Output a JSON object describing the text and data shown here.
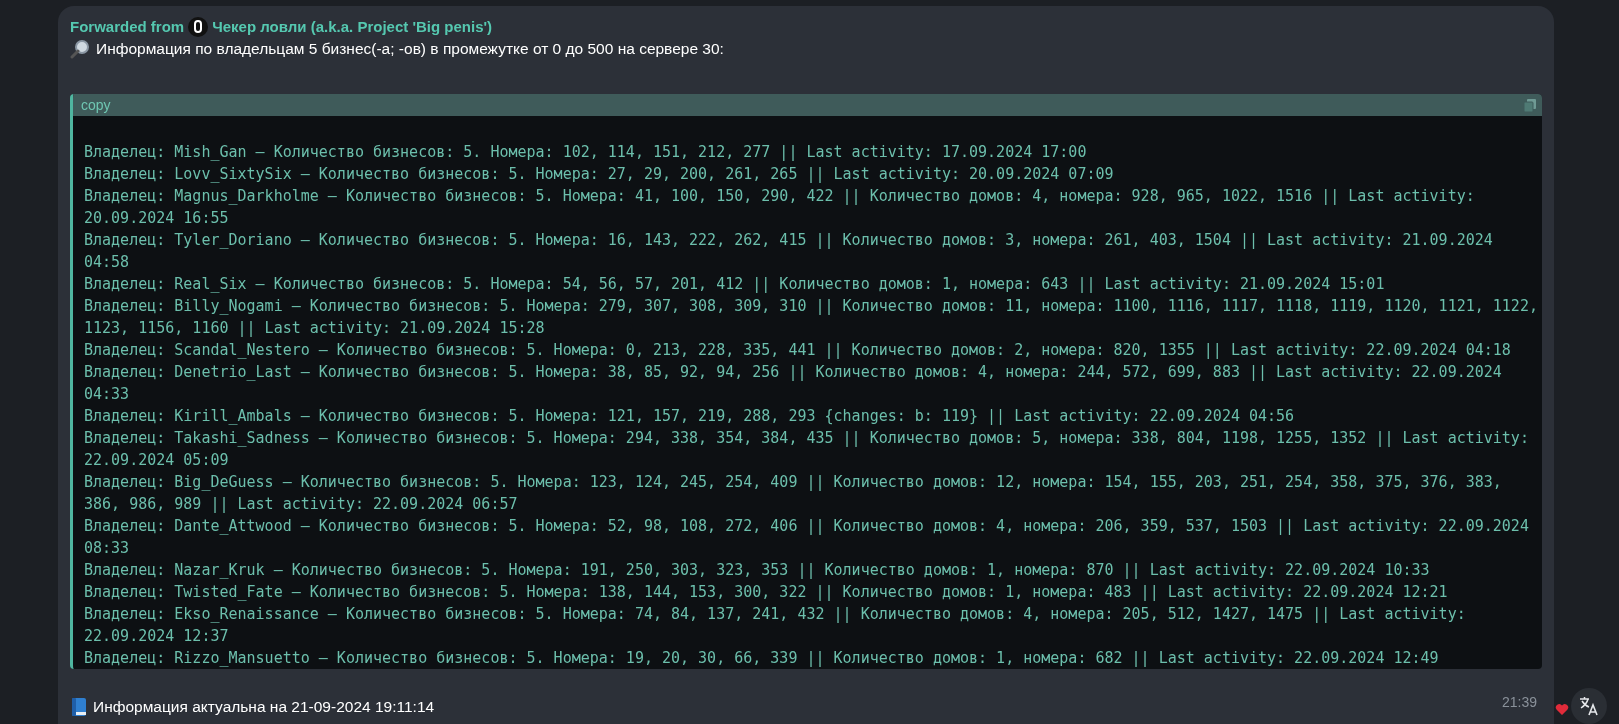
{
  "message": {
    "forwarded_label": "Forwarded from",
    "forwarded_source": "Чекер ловли (a.k.a. Project 'Big penis')",
    "intro": "Информация по владельцам 5 бизнес(-а; -ов) в промежутке от 0 до 500 на сервере 30:",
    "code_block": {
      "label": "copy",
      "lines": [
        "Владелец: Mish_Gan – Количество бизнесов: 5. Номера: 102, 114, 151, 212, 277 || Last activity: 17.09.2024 17:00",
        "Владелец: Lovv_SixtySix – Количество бизнесов: 5. Номера: 27, 29, 200, 261, 265 || Last activity: 20.09.2024 07:09",
        "Владелец: Magnus_Darkholme – Количество бизнесов: 5. Номера: 41, 100, 150, 290, 422 || Количество домов: 4, номера: 928, 965, 1022, 1516 || Last activity: 20.09.2024 16:55",
        "Владелец: Tyler_Doriano – Количество бизнесов: 5. Номера: 16, 143, 222, 262, 415 || Количество домов: 3, номера: 261, 403, 1504 || Last activity: 21.09.2024 04:58",
        "Владелец: Real_Six – Количество бизнесов: 5. Номера: 54, 56, 57, 201, 412 || Количество домов: 1, номера: 643 || Last activity: 21.09.2024 15:01",
        "Владелец: Billy_Nogami – Количество бизнесов: 5. Номера: 279, 307, 308, 309, 310 || Количество домов: 11, номера: 1100, 1116, 1117, 1118, 1119, 1120, 1121, 1122, 1123, 1156, 1160 || Last activity: 21.09.2024 15:28",
        "Владелец: Scandal_Nestero – Количество бизнесов: 5. Номера: 0, 213, 228, 335, 441 || Количество домов: 2, номера: 820, 1355 || Last activity: 22.09.2024 04:18",
        "Владелец: Denetrio_Last – Количество бизнесов: 5. Номера: 38, 85, 92, 94, 256 || Количество домов: 4, номера: 244, 572, 699, 883 || Last activity: 22.09.2024 04:33",
        "Владелец: Kirill_Ambals – Количество бизнесов: 5. Номера: 121, 157, 219, 288, 293 {changes: b: 119} || Last activity: 22.09.2024 04:56",
        "Владелец: Takashi_Sadness – Количество бизнесов: 5. Номера: 294, 338, 354, 384, 435 || Количество домов: 5, номера: 338, 804, 1198, 1255, 1352 || Last activity: 22.09.2024 05:09",
        "Владелец: Big_DeGuess – Количество бизнесов: 5. Номера: 123, 124, 245, 254, 409 || Количество домов: 12, номера: 154, 155, 203, 251, 254, 358, 375, 376, 383, 386, 986, 989 || Last activity: 22.09.2024 06:57",
        "Владелец: Dante_Attwood – Количество бизнесов: 5. Номера: 52, 98, 108, 272, 406 || Количество домов: 4, номера: 206, 359, 537, 1503 || Last activity: 22.09.2024 08:33",
        "Владелец: Nazar_Kruk – Количество бизнесов: 5. Номера: 191, 250, 303, 323, 353 || Количество домов: 1, номера: 870 || Last activity: 22.09.2024 10:33",
        "Владелец: Twisted_Fate – Количество бизнесов: 5. Номера: 138, 144, 153, 300, 322 || Количество домов: 1, номера: 483 || Last activity: 22.09.2024 12:21",
        "Владелец: Ekso_Renaissance – Количество бизнесов: 5. Номера: 74, 84, 137, 241, 432 || Количество домов: 4, номера: 205, 512, 1427, 1475 || Last activity: 22.09.2024 12:37",
        "Владелец: Rizzo_Mansuetto – Количество бизнесов: 5. Номера: 19, 20, 30, 66, 339 || Количество домов: 1, номера: 682 || Last activity: 22.09.2024 12:49"
      ]
    },
    "footer": "Информация актуальна на 21-09-2024 19:11:14",
    "time": "21:39"
  }
}
